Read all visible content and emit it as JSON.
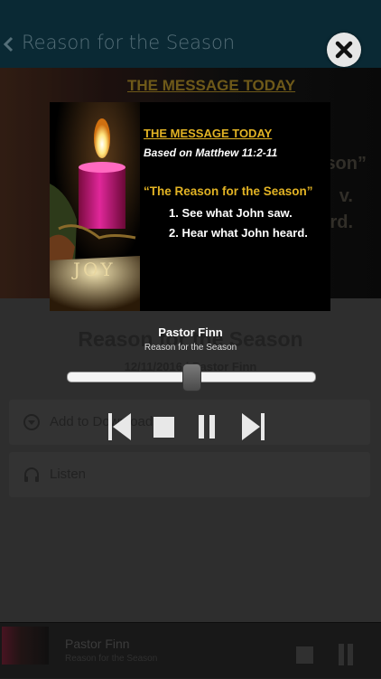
{
  "header": {
    "title": "Reason for the Season"
  },
  "hero": {
    "heading": "THE MESSAGE TODAY",
    "ghost_text_1": "son”",
    "ghost_text_2": "v.",
    "ghost_text_3": "rd."
  },
  "detail": {
    "title": "Reason for the Season",
    "meta": "12/11/2016 | Pastor Finn"
  },
  "actions": [
    {
      "label": "Add to Downloads",
      "icon": "download-icon"
    },
    {
      "label": "Listen",
      "icon": "headphones-icon"
    }
  ],
  "mini_player": {
    "title": "Pastor Finn",
    "subtitle": "Reason for the Season"
  },
  "player": {
    "artwork": {
      "heading": "THE MESSAGE TODAY",
      "subheading": "Based on Matthew 11:2-11",
      "quote": "“The Reason for the Season”",
      "points": [
        "1.  See what John saw.",
        "2.  Hear what John heard."
      ],
      "candle_label": "JOY"
    },
    "track_title": "Pastor Finn",
    "track_subtitle": "Reason for the Season",
    "progress": 0.5,
    "state": "playing"
  },
  "colors": {
    "header_bg": "#0d3441",
    "accent_gold": "#e2b324",
    "candle_pink": "#c8186e"
  }
}
